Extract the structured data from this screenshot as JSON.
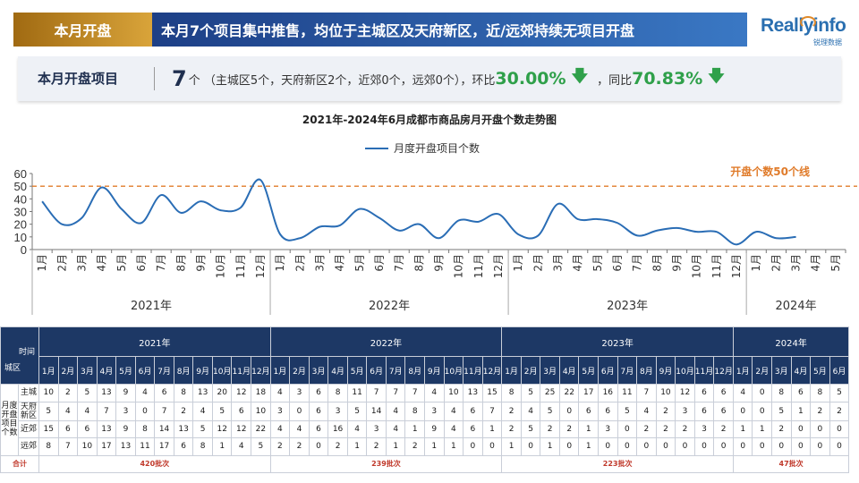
{
  "header": {
    "tag": "本月开盘",
    "headline": "本月7个项目集中推售，均位于主城区及天府新区，近/远郊持续无项目开盘"
  },
  "logo": {
    "text": "Reallyinfo",
    "sub": "锐理数据"
  },
  "info": {
    "label": "本月开盘项目",
    "count": "7",
    "detail": "个 （主城区5个，天府新区2个，近郊0个，远郊0个），环比",
    "mom": "30.00%",
    "yoy_label": "，同比",
    "yoy": "70.83%",
    "trend_icon": "arrow-down-icon"
  },
  "chart_data": {
    "type": "line",
    "title": "2021年-2024年6月成都市商品房月开盘个数走势图",
    "series": [
      {
        "name": "月度开盘项目个数",
        "color": "#2a6db5",
        "values": [
          38,
          20,
          25,
          49,
          32,
          21,
          43,
          29,
          38,
          31,
          33,
          55,
          12,
          9,
          18,
          19,
          32,
          25,
          15,
          20,
          9,
          23,
          22,
          28,
          12,
          11,
          36,
          24,
          24,
          21,
          11,
          15,
          17,
          14,
          14,
          4,
          14,
          9,
          10
        ]
      }
    ],
    "months": [
      "1月",
      "2月",
      "3月",
      "4月",
      "5月",
      "6月",
      "7月",
      "8月",
      "9月",
      "10月",
      "11月",
      "12月",
      "1月",
      "2月",
      "3月",
      "4月",
      "5月",
      "6月",
      "7月",
      "8月",
      "9月",
      "10月",
      "11月",
      "12月",
      "1月",
      "2月",
      "3月",
      "4月",
      "5月",
      "6月",
      "7月",
      "8月",
      "9月",
      "10月",
      "11月",
      "12月",
      "1月",
      "2月",
      "3月",
      "4月",
      "5月"
    ],
    "years": [
      {
        "label": "2021年",
        "span": 12
      },
      {
        "label": "2022年",
        "span": 12
      },
      {
        "label": "2023年",
        "span": 12
      },
      {
        "label": "2024年",
        "span": 5
      }
    ],
    "ylim": [
      0,
      60
    ],
    "yticks": [
      0,
      10,
      20,
      30,
      40,
      50,
      60
    ],
    "reference_line": {
      "value": 50,
      "label": "开盘个数50个线",
      "color": "#e07b2a"
    }
  },
  "table": {
    "corner_top": "时间",
    "corner_bottom": "城区",
    "years": [
      {
        "label": "2021年",
        "span": 12
      },
      {
        "label": "2022年",
        "span": 12
      },
      {
        "label": "2023年",
        "span": 12
      },
      {
        "label": "2024年",
        "span": 6
      }
    ],
    "months": [
      "1月",
      "2月",
      "3月",
      "4月",
      "5月",
      "6月",
      "7月",
      "8月",
      "9月",
      "10月",
      "11月",
      "12月",
      "1月",
      "2月",
      "3月",
      "4月",
      "5月",
      "6月",
      "7月",
      "8月",
      "9月",
      "10月",
      "11月",
      "12月",
      "1月",
      "2月",
      "3月",
      "4月",
      "5月",
      "6月",
      "7月",
      "8月",
      "9月",
      "10月",
      "11月",
      "12月",
      "1月",
      "2月",
      "3月",
      "4月",
      "5月",
      "6月"
    ],
    "group_label": "月度开盘项目个数",
    "rows": [
      {
        "name": "主城",
        "values": [
          10,
          2,
          5,
          13,
          9,
          4,
          6,
          8,
          13,
          20,
          12,
          18,
          4,
          3,
          6,
          8,
          11,
          7,
          7,
          7,
          4,
          10,
          13,
          15,
          8,
          5,
          25,
          22,
          17,
          16,
          11,
          7,
          10,
          12,
          6,
          6,
          4,
          0,
          8,
          6,
          8,
          5
        ]
      },
      {
        "name": "天府新区",
        "values": [
          5,
          4,
          4,
          7,
          3,
          0,
          7,
          2,
          4,
          5,
          6,
          10,
          3,
          0,
          6,
          3,
          5,
          14,
          4,
          8,
          3,
          4,
          6,
          7,
          2,
          4,
          5,
          0,
          6,
          6,
          5,
          4,
          2,
          3,
          6,
          6,
          0,
          0,
          5,
          1,
          2,
          2
        ]
      },
      {
        "name": "近郊",
        "values": [
          15,
          6,
          6,
          13,
          9,
          8,
          14,
          13,
          5,
          12,
          12,
          22,
          4,
          4,
          6,
          16,
          4,
          3,
          4,
          1,
          9,
          4,
          6,
          1,
          2,
          5,
          2,
          2,
          1,
          3,
          0,
          2,
          2,
          2,
          3,
          2,
          1,
          1,
          2,
          0,
          0,
          0
        ]
      },
      {
        "name": "远郊",
        "values": [
          8,
          7,
          10,
          17,
          13,
          11,
          17,
          6,
          8,
          1,
          4,
          5,
          2,
          2,
          0,
          2,
          1,
          2,
          1,
          2,
          1,
          1,
          0,
          0,
          1,
          0,
          1,
          0,
          1,
          0,
          0,
          0,
          0,
          0,
          0,
          0,
          0,
          0,
          0,
          0,
          0,
          0
        ]
      }
    ],
    "total_label": "合计",
    "totals": [
      "420批次",
      "239批次",
      "223批次",
      "47批次"
    ]
  }
}
